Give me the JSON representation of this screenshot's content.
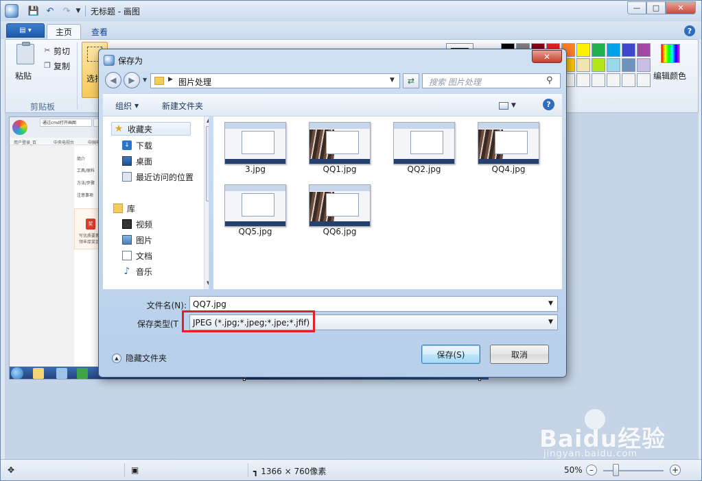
{
  "window": {
    "title": "无标题 - 画图",
    "icons": {
      "save": "save-icon",
      "undo": "undo-icon",
      "redo": "redo-icon",
      "minimize": "minimize-icon",
      "maximize": "maximize-icon",
      "close": "close-icon"
    }
  },
  "ribbon": {
    "tabs": [
      {
        "label": "主页"
      },
      {
        "label": "查看"
      }
    ],
    "clipboard": {
      "paste": "粘贴",
      "cut": "剪切",
      "copy": "复制",
      "group_label": "剪贴板"
    },
    "select": {
      "label": "选择"
    },
    "edit_colors": "编辑颜色",
    "palette": [
      "#000000",
      "#7f7f7f",
      "#880015",
      "#ed1c24",
      "#ff7f27",
      "#fff200",
      "#22b14c",
      "#00a2e8",
      "#3f48cc",
      "#a349a4",
      "#ffffff",
      "#c3c3c3",
      "#b97a57",
      "#ffaec9",
      "#ffc90e",
      "#efe4b0",
      "#b5e61d",
      "#99d9ea",
      "#7092be",
      "#c8bfe7",
      "#f4f4f4",
      "#f4f4f4",
      "#f4f4f4",
      "#f4f4f4",
      "#f4f4f4",
      "#f4f4f4",
      "#f4f4f4",
      "#f4f4f4",
      "#f4f4f4",
      "#f4f4f4"
    ]
  },
  "canvas_preview": {
    "tabs": [
      "通过cmd打开画图"
    ],
    "bookmarks": [
      "用户登录_百",
      "中央电视台",
      "中国电"
    ],
    "menu_items": [
      "简介",
      "工具/原料",
      "方法/步骤",
      "注意事项"
    ],
    "ad_text": [
      "写优质要素",
      "领丰厚奖金"
    ]
  },
  "statusbar": {
    "dimensions": "1366 × 760像素",
    "zoom": "50%",
    "zoom_fraction": 0.2
  },
  "watermark": {
    "brand": "Baidu经验",
    "url": "jingyan.baidu.com"
  },
  "dialog": {
    "title": "保存为",
    "address": {
      "path": "图片处理"
    },
    "search": {
      "placeholder": "搜索 图片处理"
    },
    "toolbar": {
      "organize": "组织",
      "new_folder": "新建文件夹"
    },
    "nav": {
      "favorites": "收藏夹",
      "items_fav": [
        "下载",
        "桌面",
        "最近访问的位置"
      ],
      "libraries": "库",
      "items_lib": [
        "视频",
        "图片",
        "文档",
        "音乐"
      ]
    },
    "files": [
      {
        "name": "3.jpg",
        "kind": "window"
      },
      {
        "name": "QQ1.jpg",
        "kind": "photo"
      },
      {
        "name": "QQ2.jpg",
        "kind": "window"
      },
      {
        "name": "QQ4.jpg",
        "kind": "photo"
      },
      {
        "name": "QQ5.jpg",
        "kind": "window"
      },
      {
        "name": "QQ6.jpg",
        "kind": "photo"
      }
    ],
    "filename": {
      "label": "文件名(N):",
      "value": "QQ7.jpg"
    },
    "filetype": {
      "label": "保存类型(T",
      "value": "JPEG (*.jpg;*.jpeg;*.jpe;*.jfif)"
    },
    "hide_folders": "隐藏文件夹",
    "save_button": "保存(S)",
    "cancel_button": "取消",
    "highlight_color": "#e0202a"
  }
}
